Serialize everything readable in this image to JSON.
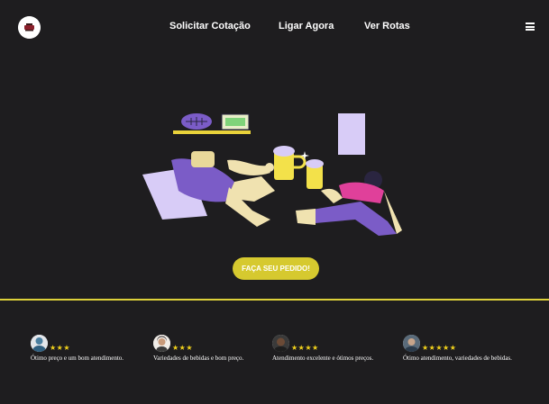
{
  "header": {
    "logo": "logo-icon",
    "nav": [
      "Solicitar Cotação",
      "Ligar Agora",
      "Ver Rotas"
    ],
    "menu_icon": "hamburger-menu-icon"
  },
  "hero": {
    "illustration": "friends-toasting-beer-illustration",
    "cta_label": "FAÇA SEU PEDIDO!"
  },
  "colors": {
    "background": "#1e1d1f",
    "accent": "#d6c92f",
    "divider": "#ddd13a",
    "stars": "#f2d21b",
    "illustration_purple": "#7b5cc7"
  },
  "reviews": [
    {
      "stars": 3,
      "star_text": "★★★",
      "text": "Ótimo preço e um bom atendimento."
    },
    {
      "stars": 3,
      "star_text": "★★★",
      "text": "Variedades de bebidas e bom preço."
    },
    {
      "stars": 4,
      "star_text": "★★★★",
      "text": "Atendimento excelente e ótimos preços."
    },
    {
      "stars": 5,
      "star_text": "★★★★★",
      "text": "Ótimo atendimento, variedades de bebidas."
    }
  ]
}
